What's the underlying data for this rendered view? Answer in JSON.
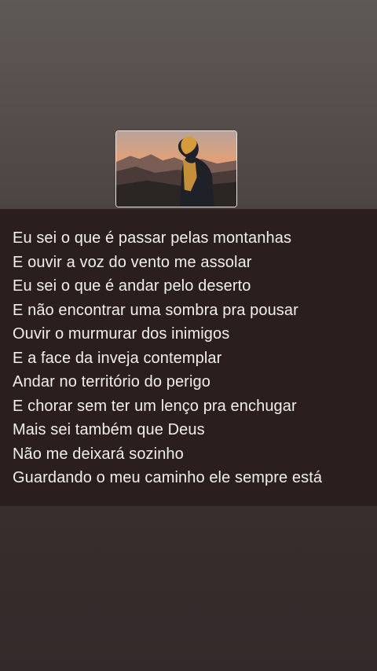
{
  "cover": {
    "icon": "hooded-person-mountains-photo",
    "colors": {
      "sky_top": "#b9a39a",
      "sky_glow": "#e8a073",
      "mountain": "#7a5d55",
      "hoodie": "#d69b3a"
    }
  },
  "lyrics": {
    "lines": [
      "Eu sei o que é passar pelas montanhas",
      "E ouvir a voz do vento me assolar",
      "Eu sei o que é andar pelo deserto",
      "E não encontrar uma sombra pra pousar",
      "Ouvir o murmurar dos inimigos",
      "E a face da inveja contemplar",
      "Andar no território do perigo",
      "E chorar sem ter um lenço pra enchugar",
      "Mais sei também que Deus",
      "Não me deixará sozinho",
      "Guardando o meu caminho ele sempre está"
    ]
  }
}
